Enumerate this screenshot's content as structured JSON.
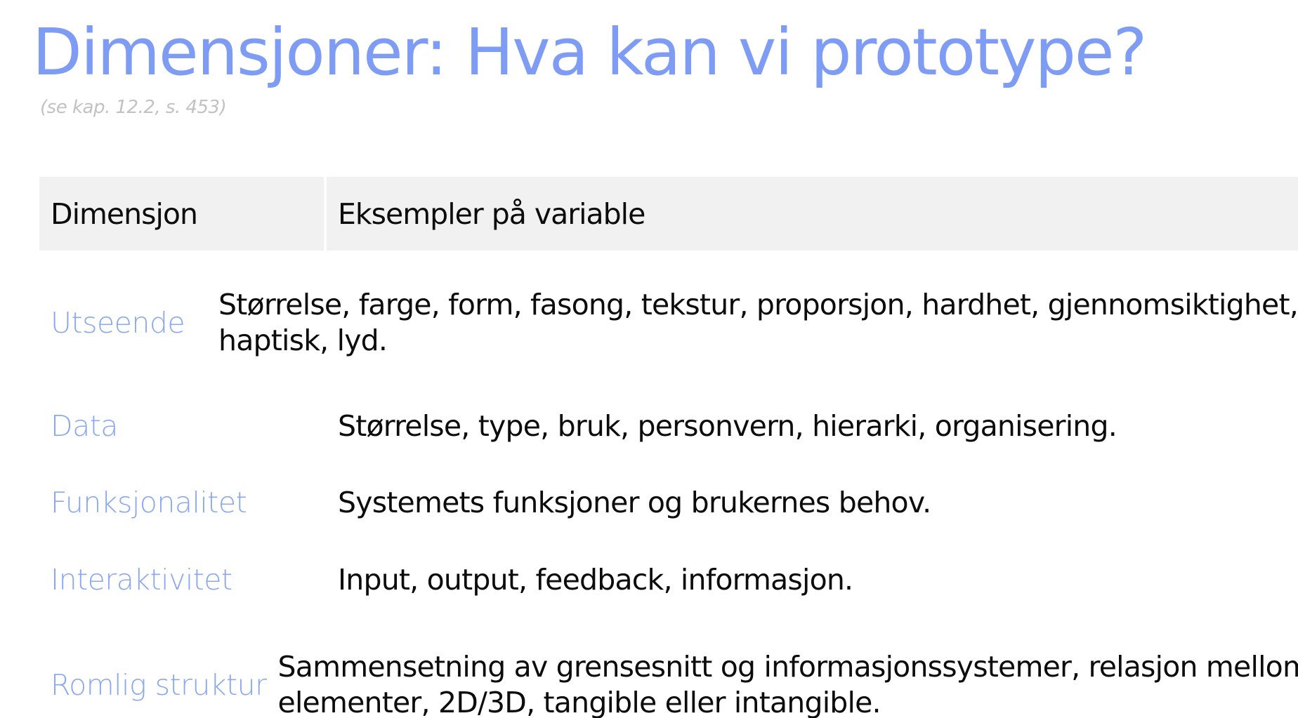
{
  "slide": {
    "title": "Dimensjoner: Hva kan vi prototype?",
    "subtitle": "(se kap. 12.2, s. 453)",
    "accent_color": "#7f9cf5",
    "dimension_color": "#8aa8f0"
  },
  "table": {
    "headers": [
      "Dimensjon",
      "Eksempler på variable"
    ],
    "rows": [
      {
        "dimension": "Utseende",
        "examples_line1": "Størrelse, farge, form, fasong, tekstur, proporsjon, hardhet, gjennomsiktighet,",
        "examples_line2": "haptisk, lyd."
      },
      {
        "dimension": "Data",
        "examples_line1": "Størrelse, type, bruk, personvern, hierarki, organisering.",
        "examples_line2": ""
      },
      {
        "dimension": "Funksjonalitet",
        "examples_line1": "Systemets funksjoner og brukernes behov.",
        "examples_line2": ""
      },
      {
        "dimension": "Interaktivitet",
        "examples_line1": "Input, output, feedback, informasjon.",
        "examples_line2": ""
      },
      {
        "dimension": "Romlig struktur",
        "examples_line1": "Sammensetning av grensesnitt og informasjonssystemer, relasjon mellom",
        "examples_line2": "elementer, 2D/3D, tangible eller intangible."
      }
    ]
  }
}
